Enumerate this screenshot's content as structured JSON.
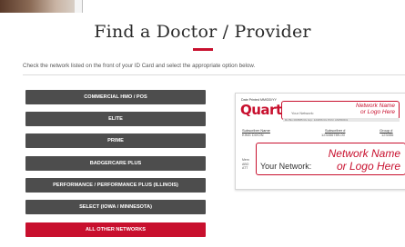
{
  "page": {
    "title": "Find a Doctor / Provider",
    "instructions": "Check the network listed on the front of your ID Card and select the appropriate option below."
  },
  "networks": [
    {
      "label": "COMMERCIAL HMO / POS",
      "style": "dark"
    },
    {
      "label": "ELITE",
      "style": "dark"
    },
    {
      "label": "PRIME",
      "style": "dark"
    },
    {
      "label": "BADGERCARE PLUS",
      "style": "dark"
    },
    {
      "label": "PERFORMANCE / PERFORMANCE PLUS (ILLINOIS)",
      "style": "dark"
    },
    {
      "label": "SELECT (IOWA / MINNESOTA)",
      "style": "dark"
    },
    {
      "label": "ALL OTHER NETWORKS",
      "style": "red"
    }
  ],
  "id_card": {
    "date_text": "Date Printed MM/DD/YY",
    "logo": "Quartz",
    "small_network_label": "Your Network:",
    "small_network_placeholder": "Network Name\nor Logo Here",
    "strip_text": "Rx Bin 003585 Rx Grp: 123456 Rx PCN: ASPROD1",
    "subscriber_name_label": "Subscriber Name",
    "subscriber_name_value": "KING DIXON",
    "subscriber_number_label": "Subscriber #",
    "subscriber_number_value": "123456789-00",
    "group_label": "Group #",
    "group_value": "123456",
    "extra_lines": "Mem\nABO\nATT",
    "large_network_label": "Your Network:",
    "large_network_placeholder": "Network Name\nor Logo Here"
  },
  "colors": {
    "brand_red": "#c8102e",
    "button_dark": "#4d4d4d"
  }
}
